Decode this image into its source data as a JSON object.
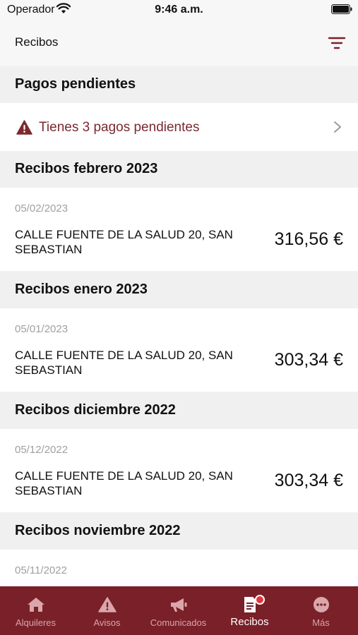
{
  "status_bar": {
    "carrier": "Operador",
    "time": "9:46 a.m."
  },
  "nav": {
    "title": "Recibos"
  },
  "pending": {
    "header": "Pagos pendientes",
    "message": "Tienes 3 pagos pendientes"
  },
  "groups": [
    {
      "header": "Recibos febrero 2023",
      "date": "05/02/2023",
      "address": "CALLE FUENTE DE LA SALUD 20, SAN SEBASTIAN",
      "amount": "316,56 €"
    },
    {
      "header": "Recibos enero 2023",
      "date": "05/01/2023",
      "address": "CALLE FUENTE DE LA SALUD 20, SAN SEBASTIAN",
      "amount": "303,34 €"
    },
    {
      "header": "Recibos diciembre 2022",
      "date": "05/12/2022",
      "address": "CALLE FUENTE DE LA SALUD 20, SAN SEBASTIAN",
      "amount": "303,34 €"
    },
    {
      "header": "Recibos noviembre 2022",
      "date": "05/11/2022"
    }
  ],
  "tabs": [
    {
      "label": "Alquileres",
      "icon": "home-icon"
    },
    {
      "label": "Avisos",
      "icon": "warning-icon"
    },
    {
      "label": "Comunicados",
      "icon": "megaphone-icon"
    },
    {
      "label": "Recibos",
      "icon": "receipt-icon",
      "active": true
    },
    {
      "label": "Más",
      "icon": "more-icon"
    }
  ],
  "colors": {
    "brand": "#7a2028",
    "alert": "#7a2a30",
    "badge": "#e8343b"
  }
}
